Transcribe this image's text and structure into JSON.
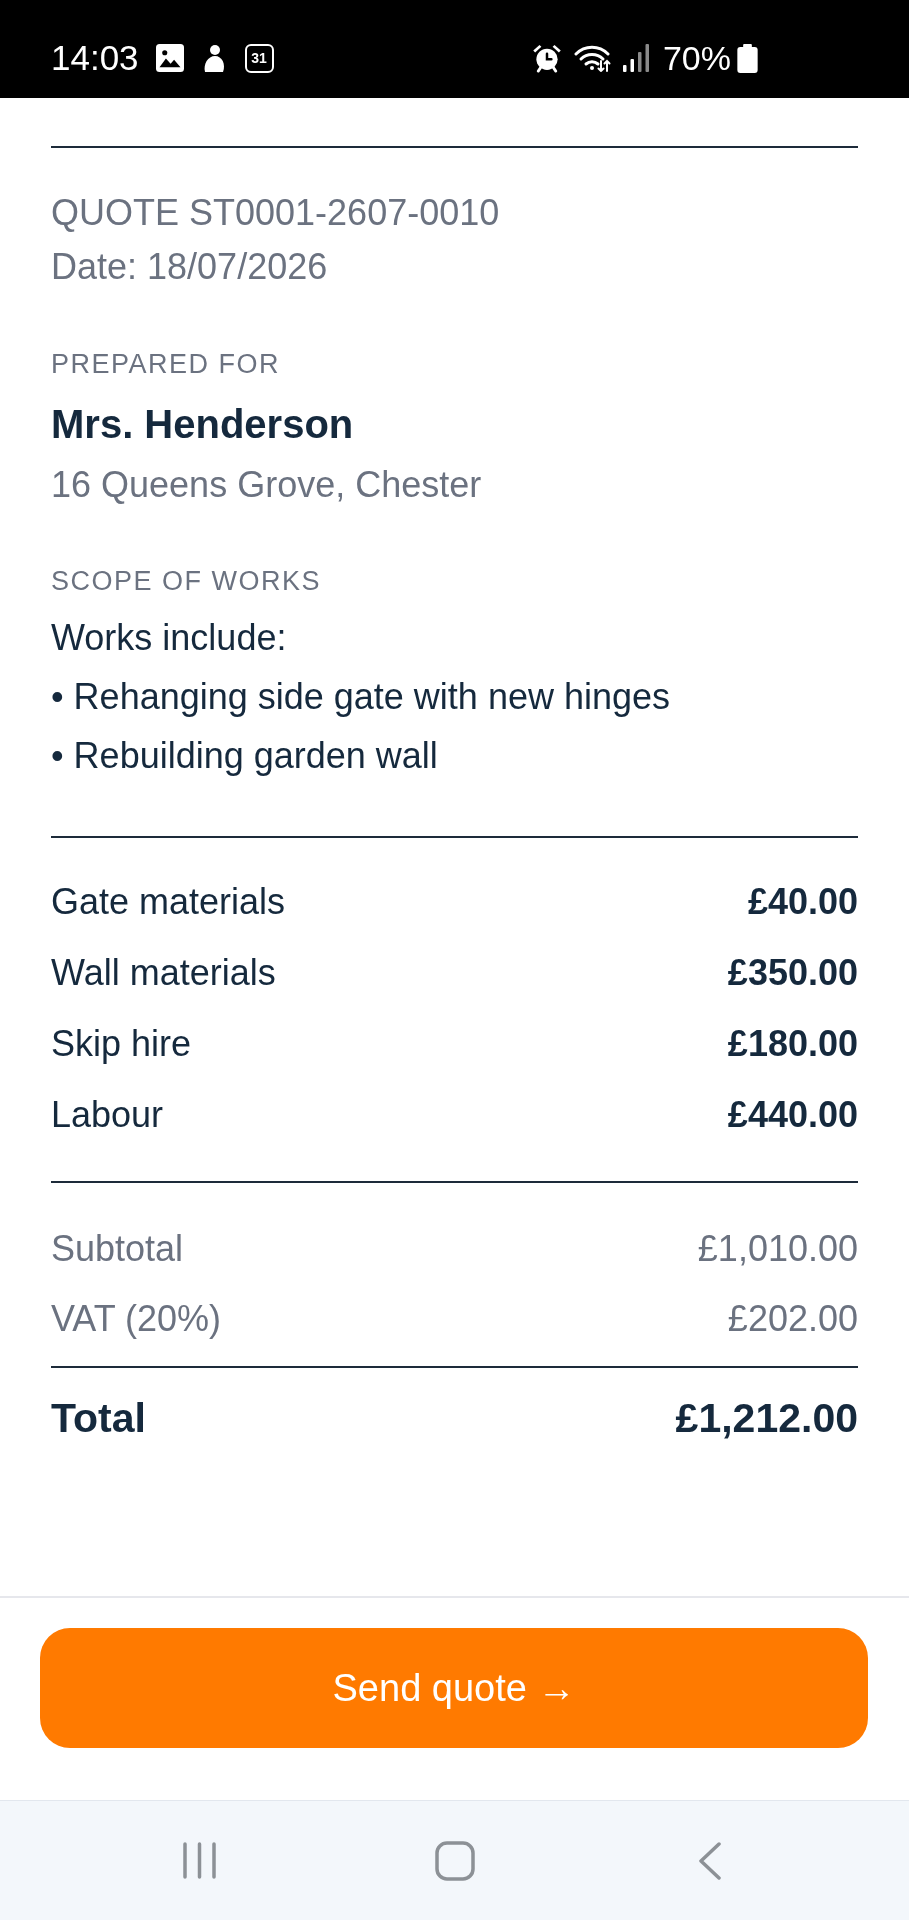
{
  "status_bar": {
    "time": "14:03",
    "calendar_day": "31",
    "battery": "70%"
  },
  "quote": {
    "number": "QUOTE ST0001-2607-0010",
    "date": "Date: 18/07/2026"
  },
  "client": {
    "heading": "PREPARED FOR",
    "name": "Mrs. Henderson",
    "address": "16 Queens Grove, Chester"
  },
  "scope": {
    "heading": "SCOPE OF WORKS",
    "intro": "Works include:",
    "items": [
      "• Rehanging side gate with new hinges",
      "• Rebuilding garden wall"
    ]
  },
  "line_items": [
    {
      "label": "Gate materials",
      "amount": "£40.00"
    },
    {
      "label": "Wall materials",
      "amount": "£350.00"
    },
    {
      "label": "Skip hire",
      "amount": "£180.00"
    },
    {
      "label": "Labour",
      "amount": "£440.00"
    }
  ],
  "summary": [
    {
      "label": "Subtotal",
      "amount": "£1,010.00"
    },
    {
      "label": "VAT (20%)",
      "amount": "£202.00"
    }
  ],
  "total": {
    "label": "Total",
    "amount": "£1,212.00"
  },
  "send_button": {
    "label": "Send quote →"
  }
}
